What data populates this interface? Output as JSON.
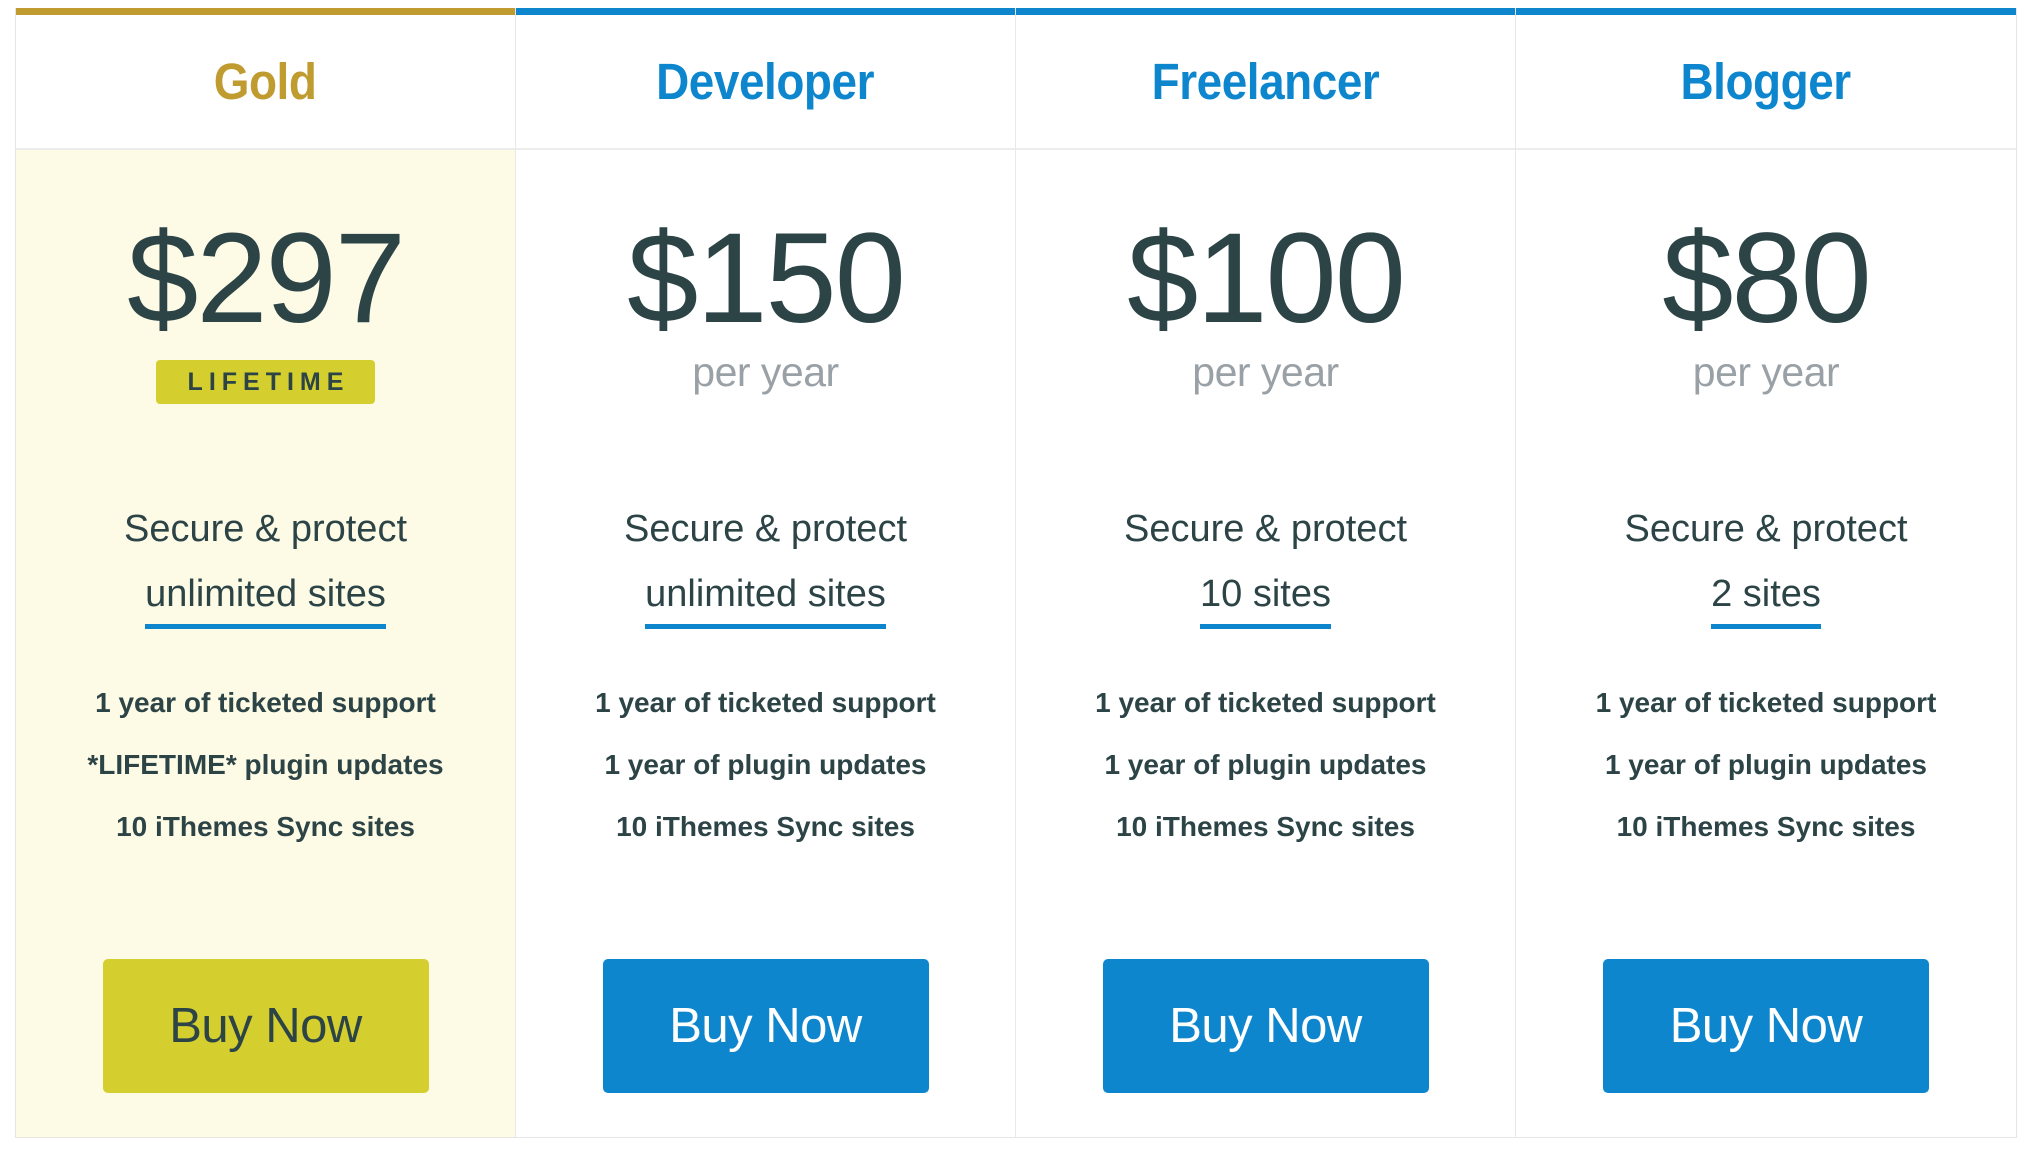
{
  "theme": {
    "accent_blue": "#0d86ce",
    "accent_gold": "#bf9b30",
    "badge_yellow": "#d4ce2f",
    "featured_background": "#fdfae6",
    "price_text": "#2d4447",
    "muted_text": "#9aa1a6"
  },
  "plans": [
    {
      "name": "Gold",
      "price": "$297",
      "price_sub": "",
      "badge": "LIFETIME",
      "secure_label": "Secure & protect",
      "sites": "unlimited sites",
      "features": [
        "1 year of ticketed support",
        "*LIFETIME* plugin updates",
        "10 iThemes Sync sites"
      ],
      "buy_label": "Buy Now"
    },
    {
      "name": "Developer",
      "price": "$150",
      "price_sub": "per year",
      "badge": "",
      "secure_label": "Secure & protect",
      "sites": "unlimited sites",
      "features": [
        "1 year of ticketed support",
        "1 year of plugin updates",
        "10 iThemes Sync sites"
      ],
      "buy_label": "Buy Now"
    },
    {
      "name": "Freelancer",
      "price": "$100",
      "price_sub": "per year",
      "badge": "",
      "secure_label": "Secure & protect",
      "sites": "10 sites",
      "features": [
        "1 year of ticketed support",
        "1 year of plugin updates",
        "10 iThemes Sync sites"
      ],
      "buy_label": "Buy Now"
    },
    {
      "name": "Blogger",
      "price": "$80",
      "price_sub": "per year",
      "badge": "",
      "secure_label": "Secure & protect",
      "sites": "2 sites",
      "features": [
        "1 year of ticketed support",
        "1 year of plugin updates",
        "10 iThemes Sync sites"
      ],
      "buy_label": "Buy Now"
    }
  ]
}
